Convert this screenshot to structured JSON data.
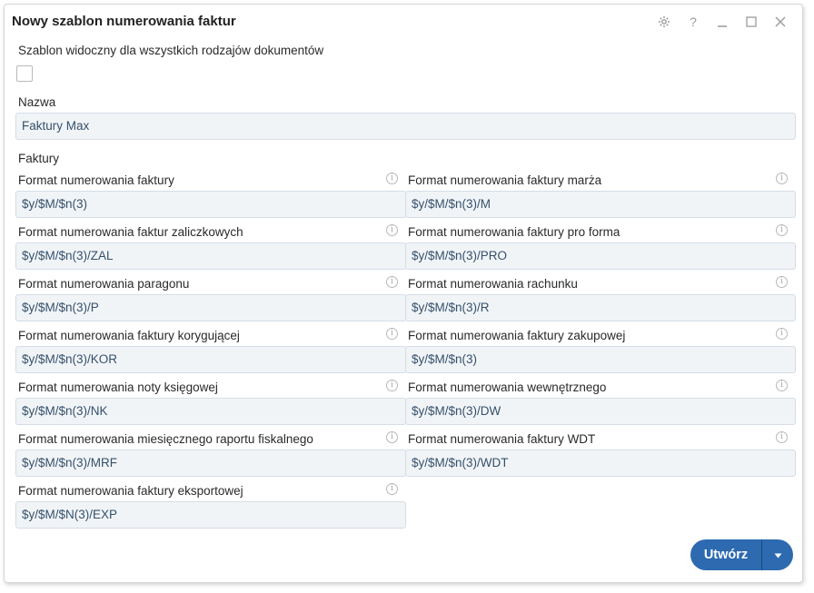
{
  "dialog": {
    "title": "Nowy szablon numerowania faktur"
  },
  "visibility": {
    "label": "Szablon widoczny dla wszystkich rodzajów dokumentów",
    "checked": false
  },
  "name": {
    "label": "Nazwa",
    "value": "Faktury Max"
  },
  "section": {
    "title": "Faktury"
  },
  "fields": [
    {
      "label": "Format numerowania faktury",
      "value": "$y/$M/$n(3)"
    },
    {
      "label": "Format numerowania faktury marża",
      "value": "$y/$M/$n(3)/M"
    },
    {
      "label": "Format numerowania faktur zaliczkowych",
      "value": "$y/$M/$n(3)/ZAL"
    },
    {
      "label": "Format numerowania faktury pro forma",
      "value": "$y/$M/$n(3)/PRO"
    },
    {
      "label": "Format numerowania paragonu",
      "value": "$y/$M/$n(3)/P"
    },
    {
      "label": "Format numerowania rachunku",
      "value": "$y/$M/$n(3)/R"
    },
    {
      "label": "Format numerowania faktury korygującej",
      "value": "$y/$M/$n(3)/KOR"
    },
    {
      "label": "Format numerowania faktury zakupowej",
      "value": "$y/$M/$n(3)"
    },
    {
      "label": "Format numerowania noty księgowej",
      "value": "$y/$M/$n(3)/NK"
    },
    {
      "label": "Format numerowania wewnętrznego",
      "value": "$y/$M/$n(3)/DW"
    },
    {
      "label": "Format numerowania miesięcznego raportu fiskalnego",
      "value": "$y/$M/$n(3)/MRF"
    },
    {
      "label": "Format numerowania faktury WDT",
      "value": "$y/$M/$n(3)/WDT"
    },
    {
      "label": "Format numerowania faktury eksportowej",
      "value": "$y/$M/$N(3)/EXP"
    }
  ],
  "footer": {
    "create_label": "Utwórz"
  },
  "icons": {
    "settings": "gear-icon",
    "help": "question-icon",
    "minimize": "minimize-icon",
    "maximize": "maximize-icon",
    "close": "close-icon",
    "info": "info-icon",
    "dropdown": "caret-down-icon"
  },
  "colors": {
    "primary": "#2d6ab0",
    "input_bg": "#f1f4f7",
    "input_border": "#d5dde6",
    "input_text": "#35506b"
  }
}
